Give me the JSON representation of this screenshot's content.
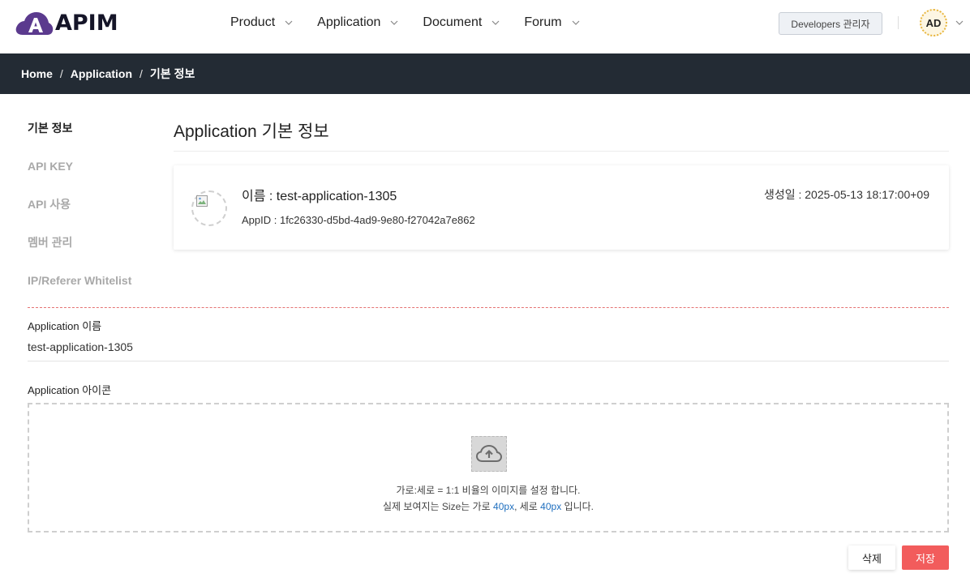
{
  "brand": {
    "logo_text": "APIM",
    "colors": {
      "accent": "#5b3a8e",
      "dark": "#232b34",
      "save": "#f25c5c",
      "highlight": "#1f6fbf"
    }
  },
  "nav": {
    "items": [
      {
        "label": "Product"
      },
      {
        "label": "Application"
      },
      {
        "label": "Document"
      },
      {
        "label": "Forum"
      }
    ],
    "developer_button": "Developers 관리자",
    "avatar_initials": "AD"
  },
  "breadcrumb": {
    "items": [
      "Home",
      "Application",
      "기본 정보"
    ],
    "separator": "/"
  },
  "sidebar": {
    "items": [
      {
        "label": "기본 정보",
        "active": true
      },
      {
        "label": "API KEY",
        "active": false
      },
      {
        "label": "API 사용",
        "active": false
      },
      {
        "label": "멤버 관리",
        "active": false
      },
      {
        "label": "IP/Referer Whitelist",
        "active": false
      }
    ]
  },
  "main": {
    "title": "Application 기본 정보",
    "card": {
      "name": "이름 : test-application-1305",
      "appid": "AppID : 1fc26330-d5bd-4ad9-9e80-f27042a7e862",
      "created": "생성일 : 2025-05-13 18:17:00+09"
    },
    "app_name_label": "Application 이름",
    "app_name_value": "test-application-1305",
    "app_icon_label": "Application 아이콘",
    "upload": {
      "line1": "가로:세로 = 1:1 비율의 이미지를 설정 합니다.",
      "line2_a": "실제 보여지는 Size는 가로 ",
      "line2_b": "40px",
      "line2_c": ", 세로 ",
      "line2_d": "40px",
      "line2_e": " 입니다."
    },
    "buttons": {
      "delete": "삭제",
      "save": "저장"
    }
  }
}
